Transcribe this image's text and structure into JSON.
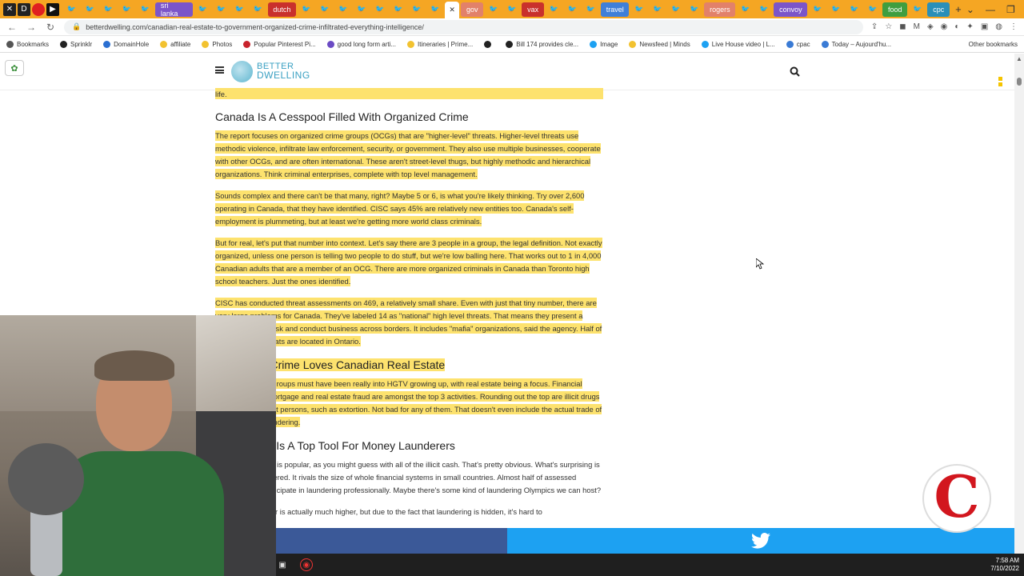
{
  "browser": {
    "tabs": [
      {
        "label": "sri lanka",
        "color": "#7b55c9"
      },
      {
        "label": "dutch",
        "color": "#c9302c"
      },
      {
        "label": "gov",
        "color": "#e2816a"
      },
      {
        "label": "vax",
        "color": "#c9302c"
      },
      {
        "label": "travel",
        "color": "#3f7fd8"
      },
      {
        "label": "rogers",
        "color": "#e2816a"
      },
      {
        "label": "convoy",
        "color": "#7b55c9"
      },
      {
        "label": "food",
        "color": "#3f9e3f"
      },
      {
        "label": "cpc",
        "color": "#2a8fb8"
      }
    ],
    "url": "betterdwelling.com/canadian-real-estate-to-government-organized-crime-infiltrated-everything-intelligence/",
    "bookmarks": [
      {
        "label": "Bookmarks",
        "color": "#555555"
      },
      {
        "label": "Sprinklr",
        "color": "#222222"
      },
      {
        "label": "DomainHole",
        "color": "#2a6fd1"
      },
      {
        "label": "affiliate",
        "color": "#f2c230"
      },
      {
        "label": "Photos",
        "color": "#f2c230"
      },
      {
        "label": "Popular Pinterest Pi...",
        "color": "#c8232c"
      },
      {
        "label": "good long form arti...",
        "color": "#6b4bc4"
      },
      {
        "label": "Itineraries | Prime...",
        "color": "#f2c230"
      },
      {
        "label": "",
        "color": "#222222"
      },
      {
        "label": "Bill 174 provides cle...",
        "color": "#222222"
      },
      {
        "label": "Image",
        "color": "#1da1f2"
      },
      {
        "label": "Newsfeed | Minds",
        "color": "#f2c230"
      },
      {
        "label": "Live House video | L...",
        "color": "#1da1f2"
      },
      {
        "label": "cpac",
        "color": "#3a7bd5"
      },
      {
        "label": "Today – Aujourd'hu...",
        "color": "#3a7bd5"
      }
    ],
    "other_bookmarks": "Other bookmarks"
  },
  "site": {
    "logo_line1": "BETTER",
    "logo_line2": "DWELLING"
  },
  "article": {
    "top_fragment": "life.",
    "sections": [
      {
        "heading": "Canada Is A Cesspool Filled With Organized Crime",
        "heading_highlighted": false,
        "paragraphs": [
          {
            "text": "The report focuses on organized crime groups (OCGs) that are \"higher-level\" threats. Higher-level threats use methodic violence, infiltrate law enforcement, security, or government. They also use multiple businesses, cooperate with other OCGs, and are often international. These aren't street-level thugs, but highly methodic and hierarchical organizations. Think criminal enterprises, complete with top level management.",
            "highlighted": true
          },
          {
            "text": "Sounds complex and there can't be that many, right? Maybe 5 or 6, is what you're likely thinking. Try over 2,600 operating in Canada, that they have identified. CISC says 45% are relatively new entities too. Canada's self-employment is plummeting, but at least we're getting more world class criminals.",
            "highlighted": true
          },
          {
            "text": "But for real, let's put that number into context. Let's say there are 3 people in a group, the legal definition. Not exactly organized, unless one person is telling two people to do stuff, but we're low balling here. That works out to 1 in 4,000 Canadian adults that are a member of an OCG. There are more organized criminals in Canada than Toronto high school teachers. Just the ones identified.",
            "highlighted": true
          },
          {
            "text": "CISC has conducted threat assessments on 469, a relatively small share. Even with just that tiny number, there are very large problems for Canada. They've labeled 14 as \"national\" high level threats. That means they present a national security risk and conduct business across borders. It includes \"mafia\" organizations, said the agency. Half of the high-level threats are located in Ontario.",
            "highlighted": true
          }
        ]
      },
      {
        "heading": "Organized Crime Loves Canadian Real Estate",
        "heading_highlighted": true,
        "paragraphs": [
          {
            "text": "Organized crime groups must have been really into HGTV growing up, with real estate being a focus. Financial crimes such as mortgage and real estate fraud are amongst the top 3 activities. Rounding out the top are illicit drugs and crimes against persons, such as extortion. Not bad for any of them. That doesn't even include the actual trade of real estate for laundering.",
            "highlighted": true
          }
        ]
      },
      {
        "heading": "Real Estate Is A Top Tool For Money Launderers",
        "heading_highlighted": false,
        "paragraphs": [
          {
            "text": "Money laundering is popular, as you might guess with all of the illicit cash. That's pretty obvious. What's surprising is the amount laundered. It rivals the size of whole financial systems in small countries. Almost half of assessed organizations participate in laundering professionally. Maybe there's some kind of laundering Olympics we can host?",
            "highlighted": false
          },
          {
            "text": "The actual number is actually much higher, but due to the fact that laundering is hidden, it's hard to",
            "highlighted": false
          }
        ]
      }
    ]
  },
  "taskbar": {
    "time": "7:58 AM",
    "date": "7/10/2022"
  },
  "channel_logo_letter": "C"
}
